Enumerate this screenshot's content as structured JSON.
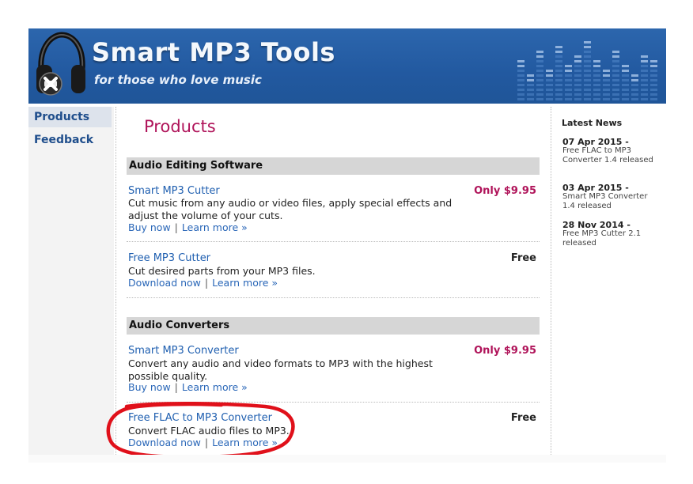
{
  "header": {
    "title": "Smart MP3 Tools",
    "tagline": "for those who love music"
  },
  "sidebar": {
    "items": [
      {
        "label": "Products",
        "active": true
      },
      {
        "label": "Feedback",
        "active": false
      }
    ]
  },
  "main": {
    "title": "Products",
    "sections": [
      {
        "title": "Audio Editing Software",
        "products": [
          {
            "name": "Smart MP3 Cutter",
            "price": "Only $9.95",
            "description": "Cut music from any audio or video files, apply special effects and adjust the volume of your cuts.",
            "primary_link": "Buy now",
            "secondary_link": "Learn more »"
          },
          {
            "name": "Free MP3 Cutter",
            "price": "Free",
            "description": "Cut desired parts from your MP3 files.",
            "primary_link": "Download now",
            "secondary_link": "Learn more »"
          }
        ]
      },
      {
        "title": "Audio Converters",
        "products": [
          {
            "name": "Smart MP3 Converter",
            "price": "Only $9.95",
            "description": "Convert any audio and video formats to MP3 with the highest possible quality.",
            "primary_link": "Buy now",
            "secondary_link": "Learn more »"
          },
          {
            "name": "Free FLAC to MP3 Converter",
            "price": "Free",
            "description": "Convert FLAC audio files to MP3.",
            "primary_link": "Download now",
            "secondary_link": "Learn more »"
          }
        ]
      }
    ]
  },
  "news": {
    "title": "Latest News",
    "items": [
      {
        "date": "07 Apr 2015 -",
        "text": "Free FLAC to MP3 Converter 1.4 released"
      },
      {
        "date": "03 Apr 2015 -",
        "text": "Smart MP3 Converter 1.4 released"
      },
      {
        "date": "28 Nov 2014 -",
        "text": "Free MP3 Cutter 2.1 released"
      }
    ]
  },
  "colors": {
    "header_blue": "#2259a0",
    "accent_magenta": "#b0145a",
    "link_blue": "#1f5fb0",
    "annotation_red": "#e0101a"
  },
  "icons": {
    "logo": "headphones-icon",
    "decoration": "equalizer-bars-icon"
  }
}
